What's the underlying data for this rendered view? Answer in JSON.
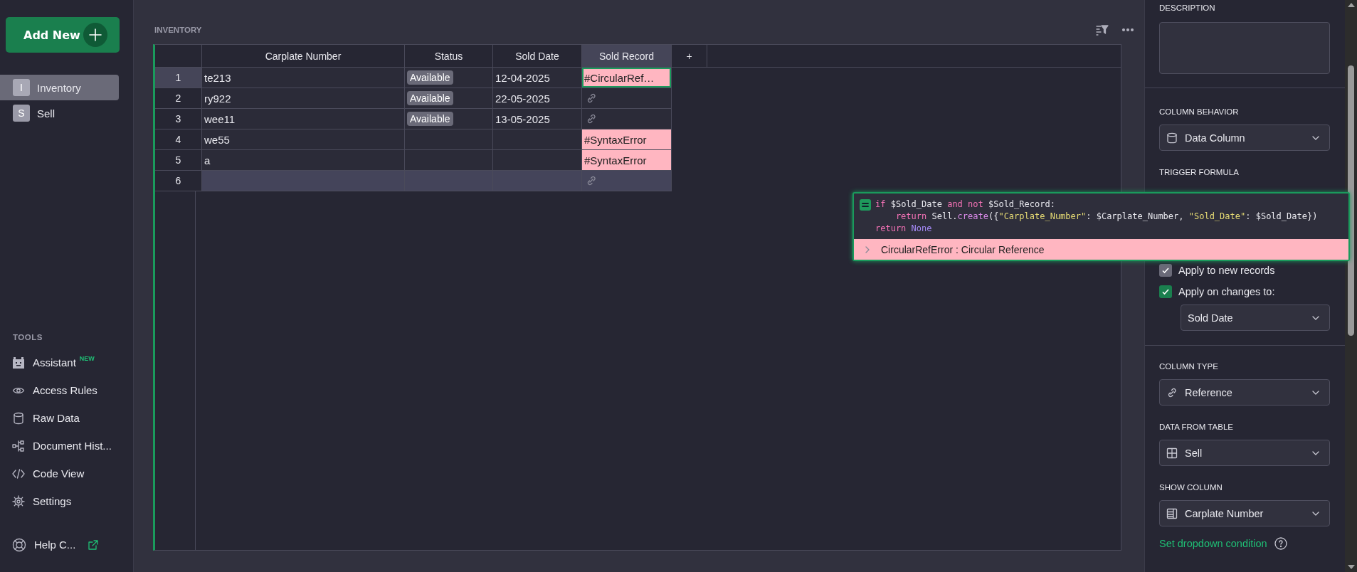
{
  "sidebar": {
    "add_new_button": {
      "label": "Add New"
    },
    "pages": [
      {
        "initial": "I",
        "label": "Inventory",
        "selected": true
      },
      {
        "initial": "S",
        "label": "Sell",
        "selected": false
      }
    ],
    "tools_heading": "TOOLS",
    "tools": [
      {
        "kind": "assistant",
        "label": "Assistant",
        "badge": "NEW"
      },
      {
        "kind": "access",
        "label": "Access Rules"
      },
      {
        "kind": "raw",
        "label": "Raw Data"
      },
      {
        "kind": "history",
        "label": "Document Hist..."
      },
      {
        "kind": "code",
        "label": "Code View"
      },
      {
        "kind": "settings",
        "label": "Settings"
      }
    ],
    "help": {
      "label": "Help C..."
    }
  },
  "table": {
    "title": "INVENTORY",
    "columns": [
      {
        "label": "Carplate Number",
        "selected": false
      },
      {
        "label": "Status",
        "selected": false
      },
      {
        "label": "Sold Date",
        "selected": false
      },
      {
        "label": "Sold Record",
        "selected": true
      }
    ],
    "add_column": "+",
    "rows": [
      {
        "kind": "record",
        "number": "1",
        "selected": true,
        "carplate": "te213",
        "status": "Available",
        "sold_date": "12-04-2025",
        "sold_record": {
          "kind": "error",
          "text": "#CircularRef…",
          "selected": true
        }
      },
      {
        "kind": "record",
        "number": "2",
        "selected": false,
        "carplate": "ry922",
        "status": "Available",
        "sold_date": "22-05-2025",
        "sold_record": {
          "kind": "link",
          "selected": false
        }
      },
      {
        "kind": "record",
        "number": "3",
        "selected": false,
        "carplate": "wee11",
        "status": "Available",
        "sold_date": "13-05-2025",
        "sold_record": {
          "kind": "link",
          "selected": false
        }
      },
      {
        "kind": "record",
        "number": "4",
        "selected": false,
        "carplate": "we55",
        "sold_record": {
          "kind": "error",
          "text": "#SyntaxError",
          "selected": false
        }
      },
      {
        "kind": "record",
        "number": "5",
        "selected": false,
        "carplate": "a",
        "sold_record": {
          "kind": "error",
          "text": "#SyntaxError",
          "selected": false
        }
      },
      {
        "kind": "new",
        "number": "6",
        "selected": false,
        "sold_record": {
          "kind": "link",
          "selected": false
        }
      }
    ]
  },
  "formula_popup": {
    "lines": [
      [
        {
          "kind": "kw",
          "text": "if"
        },
        {
          "kind": "plain",
          "text": " $Sold_Date "
        },
        {
          "kind": "kw",
          "text": "and not"
        },
        {
          "kind": "plain",
          "text": " $Sold_Record:"
        }
      ],
      [
        {
          "kind": "kw",
          "text": "    return"
        },
        {
          "kind": "plain",
          "text": " Sell."
        },
        {
          "kind": "fn",
          "text": "create"
        },
        {
          "kind": "plain",
          "text": "({"
        },
        {
          "kind": "str",
          "text": "\"Carplate_Number\""
        },
        {
          "kind": "plain",
          "text": ": $Carplate_Number, "
        },
        {
          "kind": "str",
          "text": "\"Sold_Date\""
        },
        {
          "kind": "plain",
          "text": ": $Sold_Date})"
        }
      ],
      [
        {
          "kind": "kw",
          "text": "return"
        },
        {
          "kind": "const",
          "text": " None"
        }
      ]
    ],
    "error": "CircularRefError : Circular Reference"
  },
  "right_panel": {
    "description": {
      "label": "DESCRIPTION"
    },
    "column_behavior": {
      "label": "COLUMN BEHAVIOR",
      "value": "Data Column"
    },
    "trigger_formula": {
      "label": "TRIGGER FORMULA"
    },
    "checkboxes": [
      {
        "label": "Apply to new records",
        "checked": true,
        "disabled": true
      },
      {
        "label": "Apply on changes to:",
        "checked": true,
        "disabled": false
      }
    ],
    "changes_select": {
      "value": "Sold Date"
    },
    "column_type": {
      "label": "COLUMN TYPE",
      "value": "Reference"
    },
    "data_from_table": {
      "label": "DATA FROM TABLE",
      "value": "Sell"
    },
    "show_column": {
      "label": "SHOW COLUMN",
      "value": "Carplate Number"
    },
    "dropdown_condition_link": "Set dropdown condition"
  }
}
